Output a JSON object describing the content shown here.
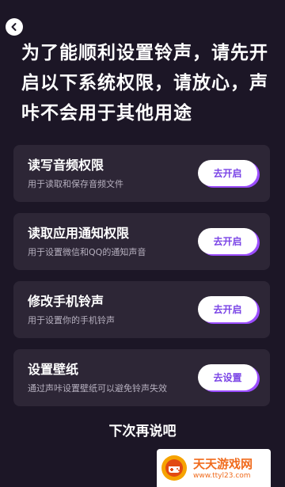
{
  "header": {
    "back_icon": "chevron-left-icon",
    "headline": "为了能顺利设置铃声，请先开启以下系统权限，请放心，声咔不会用于其他用途"
  },
  "permissions": [
    {
      "title": "读写音频权限",
      "description": "用于读取和保存音频文件",
      "button": "去开启"
    },
    {
      "title": "读取应用通知权限",
      "description": "用于设置微信和QQ的通知声音",
      "button": "去开启"
    },
    {
      "title": "修改手机铃声",
      "description": "用于设置你的手机铃声",
      "button": "去开启"
    },
    {
      "title": "设置壁纸",
      "description": "通过声咔设置壁纸可以避免铃声失效",
      "button": "去设置"
    }
  ],
  "footer": {
    "later_label": "下次再说吧"
  },
  "watermark": {
    "text": "天天游戏网",
    "url": "www.ttyl23.com",
    "logo_icon": "game-logo-icon"
  },
  "colors": {
    "background": "#1c1626",
    "card": "#2d2636",
    "accent": "#9b4dff",
    "button_text": "#7a44e6"
  }
}
